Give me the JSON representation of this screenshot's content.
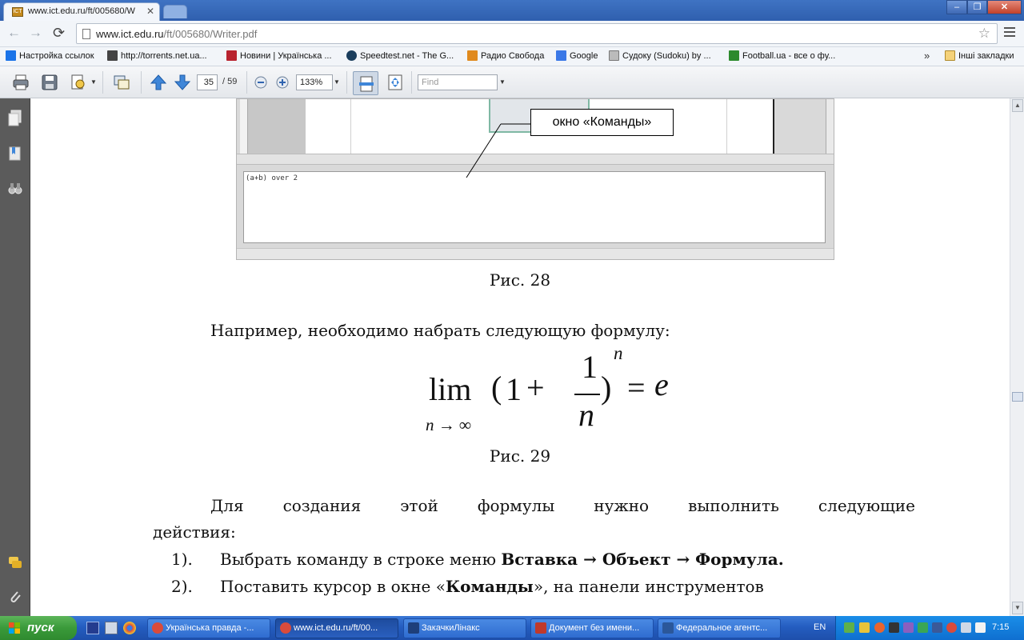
{
  "browser": {
    "tab_title": "www.ict.edu.ru/ft/005680/W",
    "url_host": "www.ict.edu.ru",
    "url_path": "/ft/005680/Writer.pdf"
  },
  "bookmarks": {
    "items": [
      {
        "label": "Настройка ссылок",
        "icon": "windows-icon",
        "color": "#1a73e8"
      },
      {
        "label": "http://torrents.net.ua...",
        "icon": "torrent-icon",
        "color": "#444444"
      },
      {
        "label": "Новини | Українська ...",
        "icon": "up-logo-icon",
        "color": "#b8232f"
      },
      {
        "label": "Speedtest.net - The G...",
        "icon": "speedtest-icon",
        "color": "#1a3d5c"
      },
      {
        "label": "Радио Свобода",
        "icon": "radio-icon",
        "color": "#e08a1e"
      },
      {
        "label": "Google",
        "icon": "google-icon",
        "color": "#3b78e7"
      },
      {
        "label": "Судоку (Sudoku) by ...",
        "icon": "sudoku-icon",
        "color": "#888888"
      },
      {
        "label": "Football.ua - все о фу...",
        "icon": "football-icon",
        "color": "#2c8a2c"
      }
    ],
    "more": "»",
    "other_folder": "Інші закладки"
  },
  "pdf_toolbar": {
    "page_current": "35",
    "page_total": "/ 59",
    "zoom": "133%",
    "find_placeholder": "Find"
  },
  "document": {
    "callout_label": "окно «Команды»",
    "command_text": "(a+b) over 2",
    "caption_28": "Рис. 28",
    "intro": "Например, необходимо набрать следующую формулу:",
    "formula": {
      "lim": "lim",
      "sub": "n → ∞",
      "lparen": "(",
      "one": "1",
      "plus": "+",
      "num": "1",
      "den": "n",
      "rparen": ")",
      "exp": "n",
      "eq": "=",
      "e": "e"
    },
    "caption_29": "Рис. 29",
    "para_line1_words": [
      "Для",
      "создания",
      "этой",
      "формулы",
      "нужно",
      "выполнить",
      "следующие"
    ],
    "para_line2": "действия:",
    "step1_num": "1).",
    "step1_text": "Выбрать команду в строке меню ",
    "step1_bold": "Вставка → Объект → Формула.",
    "step2_num": "2).",
    "step2_text_a": "Поставить курсор в окне «",
    "step2_bold": "Команды",
    "step2_text_b": "», на панели инструментов"
  },
  "taskbar": {
    "start": "пуск",
    "tasks": [
      {
        "label": "Українська правда -...",
        "icon": "chrome-icon",
        "color": "#d94b3b"
      },
      {
        "label": "www.ict.edu.ru/ft/00...",
        "icon": "chrome-icon",
        "color": "#d94b3b"
      },
      {
        "label": "ЗакачкиЛінакс",
        "icon": "folder-icon",
        "color": "#1e3f7a"
      },
      {
        "label": "Документ без имени...",
        "icon": "writer-icon",
        "color": "#c0392b"
      },
      {
        "label": "Федеральное агентс...",
        "icon": "word-icon",
        "color": "#2b579a"
      }
    ],
    "lang": "EN",
    "clock": "7:15"
  }
}
